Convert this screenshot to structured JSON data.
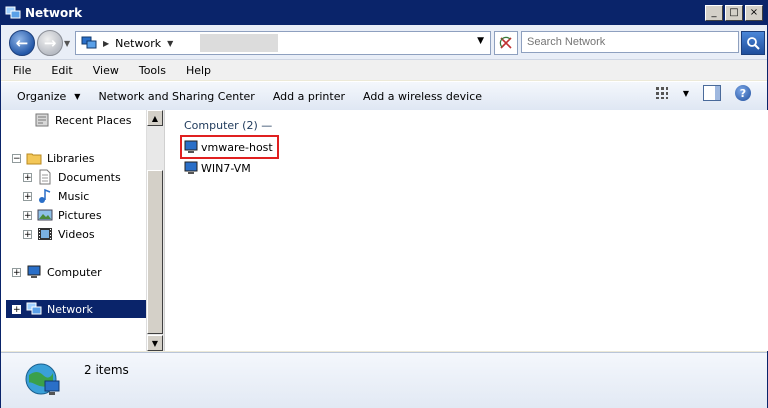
{
  "window": {
    "title": "Network",
    "buttons": {
      "minimize": "_",
      "maximize": "□",
      "close": "×"
    }
  },
  "address_bar": {
    "location": "Network",
    "search_placeholder": "Search Network"
  },
  "menu": [
    "File",
    "Edit",
    "View",
    "Tools",
    "Help"
  ],
  "commands": {
    "organize": "Organize",
    "network_sharing": "Network and Sharing Center",
    "add_printer": "Add a printer",
    "add_wireless": "Add a wireless device"
  },
  "nav_tree": {
    "recent_places": "Recent Places",
    "libraries": "Libraries",
    "documents": "Documents",
    "music": "Music",
    "pictures": "Pictures",
    "videos": "Videos",
    "computer": "Computer",
    "network": "Network"
  },
  "content": {
    "group_header": "Computer (2) —",
    "items": [
      "vmware-host",
      "WIN7-VM"
    ]
  },
  "status": {
    "count": "2 items"
  }
}
